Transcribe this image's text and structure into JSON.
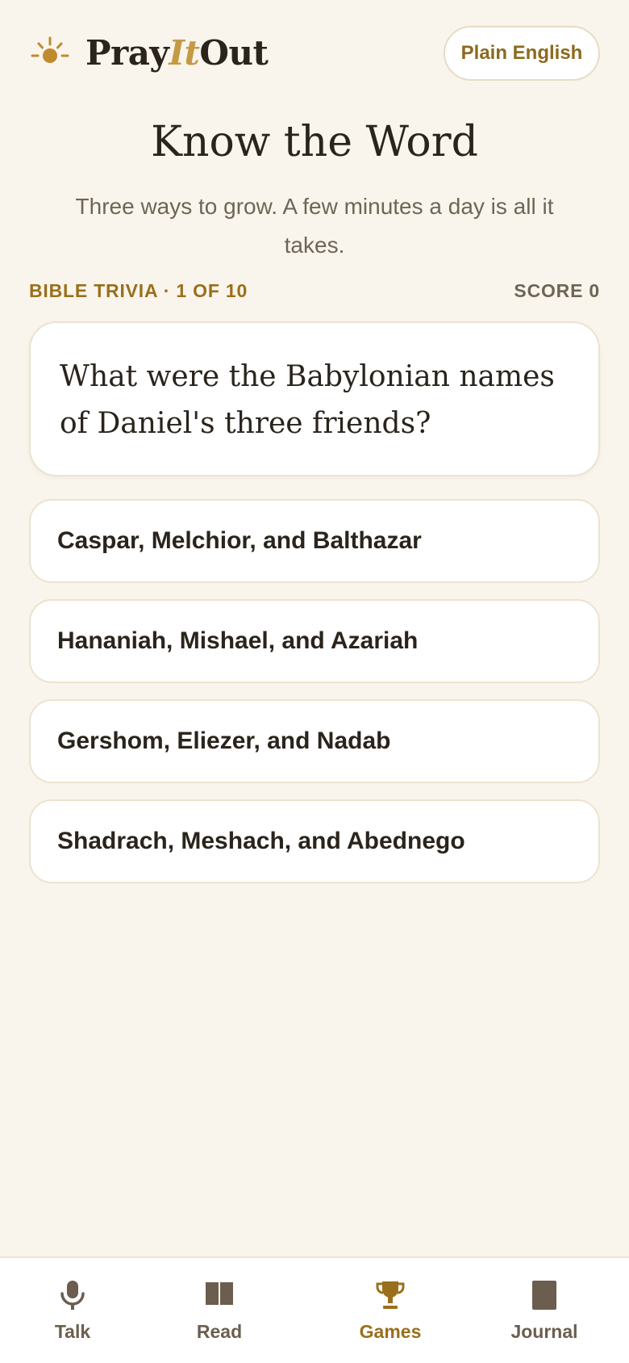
{
  "header": {
    "brand_part1": "Pray",
    "brand_part2": "It",
    "brand_part3": "Out",
    "plain_english_label": "Plain English",
    "logo_icon": "sun-icon"
  },
  "intro": {
    "title": "Know the Word",
    "subtitle": "Three ways to grow. A few minutes a day is all it takes."
  },
  "game": {
    "progress_label": "BIBLE TRIVIA · 1 OF 10",
    "score_label": "SCORE 0",
    "question": "What were the Babylonian names of Daniel's three friends?",
    "answers": [
      "Caspar, Melchior, and Balthazar",
      "Hananiah, Mishael, and Azariah",
      "Gershom, Eliezer, and Nadab",
      "Shadrach, Meshach, and Abednego"
    ]
  },
  "nav": {
    "items": [
      {
        "label": "Talk",
        "icon": "microphone-icon",
        "active": false
      },
      {
        "label": "Read",
        "icon": "book-icon",
        "active": false
      },
      {
        "label": "Games",
        "icon": "trophy-icon",
        "active": true
      },
      {
        "label": "Journal",
        "icon": "journal-icon",
        "active": false
      }
    ]
  },
  "colors": {
    "background": "#f9f5ec",
    "accent": "#9a6f1c",
    "accent_light": "#c49a45",
    "text": "#2a241c",
    "muted": "#6e6557",
    "card_border": "#ece3cf"
  }
}
